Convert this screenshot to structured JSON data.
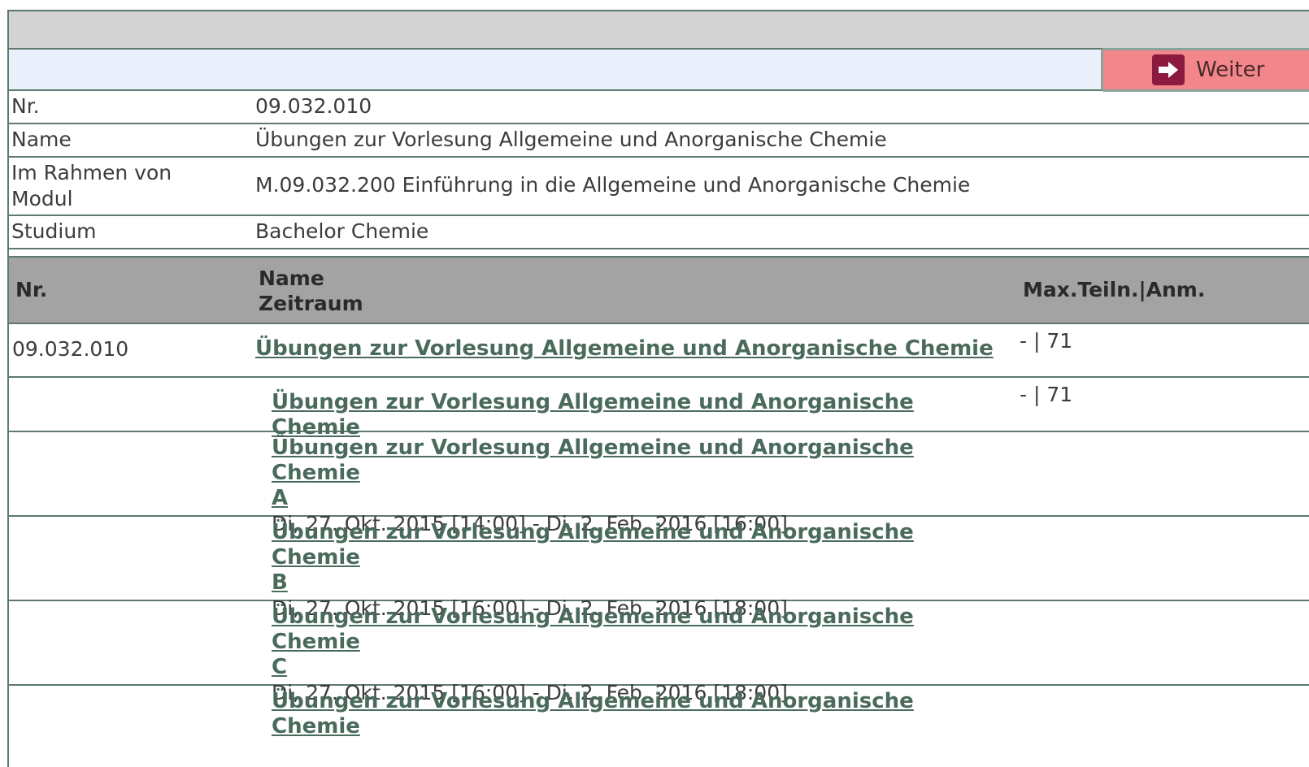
{
  "action_bar": {
    "weiter_label": "Weiter",
    "weiter_icon": "arrow-right-icon"
  },
  "info": {
    "nr_label": "Nr.",
    "nr_value": "09.032.010",
    "name_label": "Name",
    "name_value": "Übungen zur Vorlesung Allgemeine und Anorganische Chemie",
    "modul_label_line1": "Im Rahmen von",
    "modul_label_line2": "Modul",
    "modul_value": "M.09.032.200 Einführung in die Allgemeine und Anorganische Chemie",
    "studium_label": "Studium",
    "studium_value": "Bachelor Chemie"
  },
  "table": {
    "headers": {
      "nr": "Nr.",
      "name": "Name",
      "zeitraum": "Zeitraum",
      "max": "Max.Teiln.|Anm."
    },
    "main_row": {
      "nr": "09.032.010",
      "name": "Übungen zur Vorlesung Allgemeine und Anorganische Chemie",
      "max": "- | 71"
    },
    "sub_rows": [
      {
        "name": "Übungen zur Vorlesung Allgemeine und Anorganische Chemie",
        "max": "- | 71"
      },
      {
        "name_line1": "Übungen zur Vorlesung Allgemeine und Anorganische Chemie",
        "name_line2": "A",
        "period": "Di, 27. Okt. 2015 [14:00] - Di, 2. Feb. 2016 [16:00]"
      },
      {
        "name_line1": "Übungen zur Vorlesung Allgemeine und Anorganische Chemie",
        "name_line2": "B",
        "period": "Di, 27. Okt. 2015 [16:00] - Di, 2. Feb. 2016 [18:00]"
      },
      {
        "name_line1": "Übungen zur Vorlesung Allgemeine und Anorganische Chemie",
        "name_line2": "C",
        "period": "Di, 27. Okt. 2015 [16:00] - Di, 2. Feb. 2016 [18:00]"
      },
      {
        "name_line1": "Übungen zur Vorlesung Allgemeine und Anorganische Chemie"
      }
    ]
  }
}
